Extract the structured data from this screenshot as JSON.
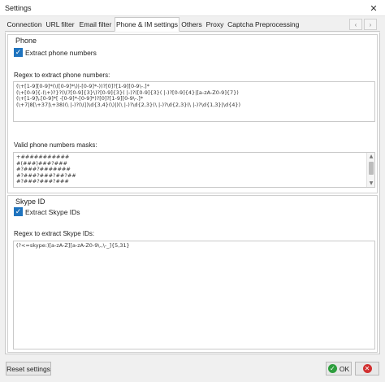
{
  "window": {
    "title": "Settings",
    "close_glyph": "✕"
  },
  "tabs": [
    {
      "label": "Connection"
    },
    {
      "label": "URL filter"
    },
    {
      "label": "Email filter"
    },
    {
      "label": "Phone & IM settings",
      "active": true
    },
    {
      "label": "Others"
    },
    {
      "label": "Proxy"
    },
    {
      "label": "Captcha"
    },
    {
      "label": "Preprocessing"
    }
  ],
  "tab_nav": {
    "prev_glyph": "‹",
    "next_glyph": "›"
  },
  "phone": {
    "group_title": "Phone",
    "extract_label": "Extract phone numbers",
    "extract_checked": true,
    "regex_label": "Regex to extract phone numbers:",
    "regex_lines": [
      "(\\+[1-9][0-9]*(\\([0-9]*\\)|-[0-9]*-))?[0]?[1-9][0-9\\-.]*",
      "(\\+[0-9]{-(\\+)?}?(\\(?[0-9]{3}\\)?[0-9]{3}( |-)?([0-9]{3}( |-)?[0-9]{4}|[a-zA-Z0-9]{7})",
      "(\\+[1-9]\\.[0-9]*[ -[0-9]*-[0-9]*)?[0]?[1-9][0-9\\-.]*",
      "(\\+7|8[\\+37|\\+38)(\\ |-)?(\\(|)\\d{3,4}(\\)|)(\\ |-)?\\d{2,3}(\\ |-)?\\d{2,3}(\\ |-)?\\d{1,3}|\\d{4})"
    ],
    "masks_label": "Valid phone numbers masks:",
    "masks_lines": [
      "+###########",
      "#(###)###?###",
      "#?###?#######",
      "#?###?###?##?##",
      "#?###?###?###"
    ],
    "scroll_up": "▲",
    "scroll_down": "▼"
  },
  "skype": {
    "group_title": "Skype ID",
    "extract_label": "Extract Skype IDs",
    "extract_checked": true,
    "regex_label": "Regex to extract Skype IDs:",
    "regex_lines": [
      "(?<=skype:)[a-zA-Z][a-zA-Z0-9\\.,\\-_]{5,31}"
    ]
  },
  "footer": {
    "reset_label": "Reset settings",
    "ok_label": "OK",
    "ok_glyph": "✓",
    "cancel_glyph": "✕"
  },
  "colors": {
    "accent": "#1e73be",
    "ok": "#2e9e3e",
    "cancel": "#d12f2f"
  }
}
